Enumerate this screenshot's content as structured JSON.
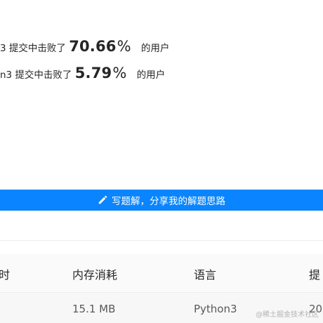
{
  "stats": {
    "runtime": {
      "prefix": "3 提交中击败了",
      "value": "70.66",
      "unit": "%",
      "suffix": "的用户"
    },
    "memory": {
      "prefix": "n3 提交中击败了",
      "value": "5.79",
      "unit": "%",
      "suffix": "的用户"
    }
  },
  "solution_bar": {
    "icon": "pencil-icon",
    "label": "写题解，分享我的解题思路",
    "color": "#0a84ff"
  },
  "table": {
    "headers": [
      "时",
      "内存消耗",
      "语言",
      "提"
    ],
    "rows": [
      {
        "memory": "15.1 MB",
        "language": "Python3",
        "submit": "20"
      }
    ]
  },
  "watermark": "@稀土掘金技术社区"
}
